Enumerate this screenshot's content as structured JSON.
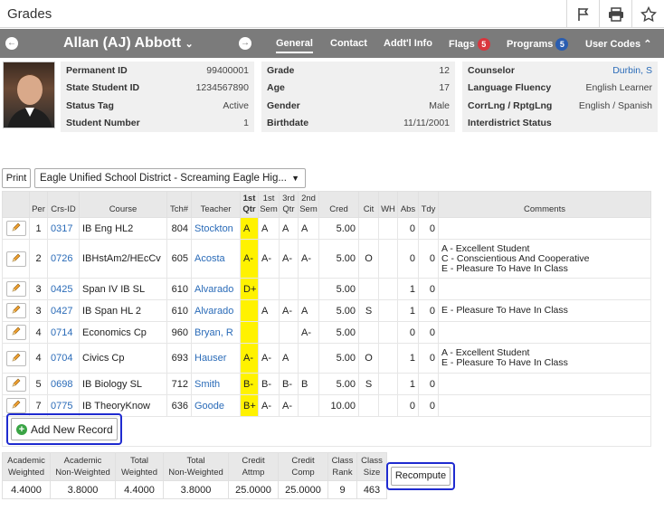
{
  "page": {
    "title": "Grades"
  },
  "toolbar": {
    "icons": [
      "flag-icon",
      "print-icon",
      "star-icon"
    ]
  },
  "student": {
    "name": "Allan (AJ) Abbott",
    "tabs": [
      {
        "label": "General",
        "active": true
      },
      {
        "label": "Contact"
      },
      {
        "label": "Addt'l Info"
      },
      {
        "label": "Flags",
        "badge": "5",
        "badge_color": "#d9363e"
      },
      {
        "label": "Programs",
        "badge": "5",
        "badge_color": "#2a5db0"
      },
      {
        "label": "User Codes"
      }
    ]
  },
  "demographics": {
    "col1": [
      {
        "label": "Permanent ID",
        "value": "99400001"
      },
      {
        "label": "State Student ID",
        "value": "1234567890"
      },
      {
        "label": "Status Tag",
        "value": "Active"
      },
      {
        "label": "Student Number",
        "value": "1"
      }
    ],
    "col2": [
      {
        "label": "Grade",
        "value": "12"
      },
      {
        "label": "Age",
        "value": "17"
      },
      {
        "label": "Gender",
        "value": "Male"
      },
      {
        "label": "Birthdate",
        "value": "11/11/2001"
      }
    ],
    "col3": [
      {
        "label": "Counselor",
        "value": "Durbin, S"
      },
      {
        "label": "Language Fluency",
        "value": "English Learner"
      },
      {
        "label": "CorrLng / RptgLng",
        "value": "English / Spanish"
      },
      {
        "label": "Interdistrict Status",
        "value": ""
      }
    ]
  },
  "controls": {
    "print_label": "Print",
    "school": "Eagle Unified School District - Screaming Eagle Hig..."
  },
  "grades": {
    "headers": {
      "per": "Per",
      "crs": "Crs-ID",
      "course": "Course",
      "tch": "Tch#",
      "teacher": "Teacher",
      "q1a": "1st",
      "q1b": "Qtr",
      "s1a": "1st",
      "s1b": "Sem",
      "q3a": "3rd",
      "q3b": "Qtr",
      "s2a": "2nd",
      "s2b": "Sem",
      "cred": "Cred",
      "cit": "Cit",
      "wh": "WH",
      "abs": "Abs",
      "tdy": "Tdy",
      "comments": "Comments"
    },
    "rows": [
      {
        "per": "1",
        "crs": "0317",
        "course": "IB Eng HL2",
        "tch": "804",
        "teacher": "Stockton",
        "q1": "A",
        "s1": "A",
        "q3": "A",
        "s2": "A",
        "cred": "5.00",
        "cit": "",
        "wh": "",
        "abs": "0",
        "tdy": "0",
        "comments": []
      },
      {
        "per": "2",
        "crs": "0726",
        "course": "IBHstAm2/HEcCv",
        "tch": "605",
        "teacher": "Acosta",
        "q1": "A-",
        "s1": "A-",
        "q3": "A-",
        "s2": "A-",
        "cred": "5.00",
        "cit": "O",
        "wh": "",
        "abs": "0",
        "tdy": "0",
        "comments": [
          "A - Excellent Student",
          "C - Conscientious And Cooperative",
          "E - Pleasure To Have In Class"
        ]
      },
      {
        "per": "3",
        "crs": "0425",
        "course": "Span IV IB SL",
        "tch": "610",
        "teacher": "Alvarado",
        "q1": "D+",
        "s1": "",
        "q3": "",
        "s2": "",
        "cred": "5.00",
        "cit": "",
        "wh": "",
        "abs": "1",
        "tdy": "0",
        "comments": []
      },
      {
        "per": "3",
        "crs": "0427",
        "course": "IB Span HL 2",
        "tch": "610",
        "teacher": "Alvarado",
        "q1": "",
        "s1": "A",
        "q3": "A-",
        "s2": "A",
        "cred": "5.00",
        "cit": "S",
        "wh": "",
        "abs": "1",
        "tdy": "0",
        "comments": [
          "E - Pleasure To Have In Class"
        ]
      },
      {
        "per": "4",
        "crs": "0714",
        "course": "Economics Cp",
        "tch": "960",
        "teacher": "Bryan, R",
        "q1": "",
        "s1": "",
        "q3": "",
        "s2": "A-",
        "cred": "5.00",
        "cit": "",
        "wh": "",
        "abs": "0",
        "tdy": "0",
        "comments": []
      },
      {
        "per": "4",
        "crs": "0704",
        "course": "Civics Cp",
        "tch": "693",
        "teacher": "Hauser",
        "q1": "A-",
        "s1": "A-",
        "q3": "A",
        "s2": "",
        "cred": "5.00",
        "cit": "O",
        "wh": "",
        "abs": "1",
        "tdy": "0",
        "comments": [
          "A - Excellent Student",
          "E - Pleasure To Have In Class"
        ]
      },
      {
        "per": "5",
        "crs": "0698",
        "course": "IB Biology SL",
        "tch": "712",
        "teacher": "Smith",
        "q1": "B-",
        "s1": "B-",
        "q3": "B-",
        "s2": "B",
        "cred": "5.00",
        "cit": "S",
        "wh": "",
        "abs": "1",
        "tdy": "0",
        "comments": []
      },
      {
        "per": "7",
        "crs": "0775",
        "course": "IB TheoryKnow",
        "tch": "636",
        "teacher": "Goode",
        "q1": "B+",
        "s1": "A-",
        "q3": "A-",
        "s2": "",
        "cred": "10.00",
        "cit": "",
        "wh": "",
        "abs": "0",
        "tdy": "0",
        "comments": []
      }
    ],
    "add_label": "Add New Record"
  },
  "summary": {
    "headers": [
      [
        "Academic",
        "Weighted"
      ],
      [
        "Academic",
        "Non-Weighted"
      ],
      [
        "Total",
        "Weighted"
      ],
      [
        "Total",
        "Non-Weighted"
      ],
      [
        "Credit",
        "Attmp"
      ],
      [
        "Credit",
        "Comp"
      ],
      [
        "Class",
        "Rank"
      ],
      [
        "Class",
        "Size"
      ]
    ],
    "values": [
      "4.4000",
      "3.8000",
      "4.4000",
      "3.8000",
      "25.0000",
      "25.0000",
      "9",
      "463"
    ],
    "recompute_label": "Recompute"
  }
}
